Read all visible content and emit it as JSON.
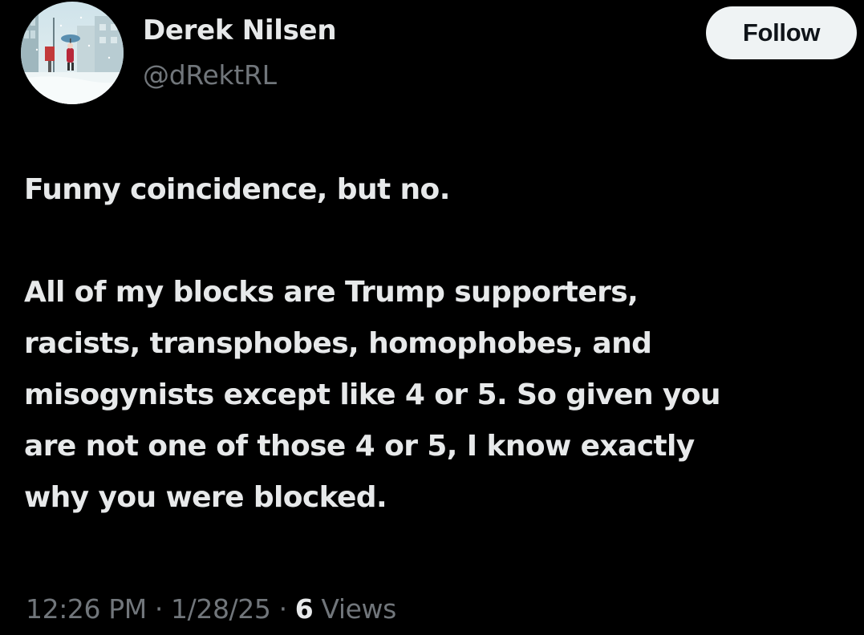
{
  "author": {
    "name": "Derek Nilsen",
    "handle": "@dRektRL",
    "avatar_icon": "profile-avatar-snowy-street-illustration"
  },
  "actions": {
    "follow_label": "Follow"
  },
  "tweet": {
    "lines": [
      "Funny coincidence, but no.",
      "",
      "All of my blocks are Trump supporters,",
      "racists, transphobes, homophobes, and",
      "misogynists except like 4 or 5. So given you",
      "are not one of those 4 or 5, I know exactly",
      "why you were blocked."
    ]
  },
  "meta": {
    "time": "12:26 PM",
    "separator": "·",
    "date": "1/28/25",
    "views_count": "6",
    "views_label": "Views"
  },
  "colors": {
    "background": "#000000",
    "primary_text": "#e7e9ea",
    "secondary_text": "#71767b",
    "follow_bg": "#eff3f4",
    "follow_text": "#0f1419"
  }
}
